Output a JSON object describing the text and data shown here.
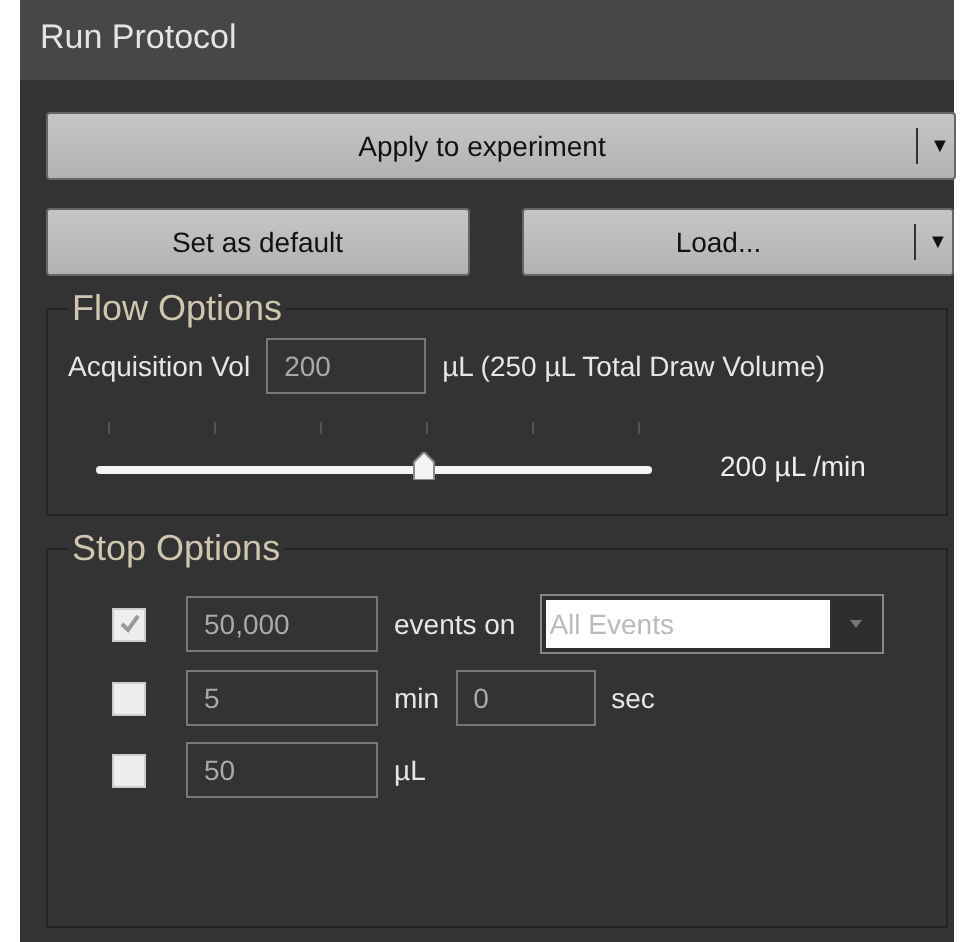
{
  "window": {
    "title": "Run Protocol"
  },
  "buttons": {
    "apply": {
      "label": "Apply to experiment",
      "arrow": "▼"
    },
    "set_default": {
      "label": "Set as default"
    },
    "load": {
      "label": "Load...",
      "arrow": "▼"
    }
  },
  "flow_options": {
    "title": "Flow Options",
    "acquisition_label": "Acquisition Vol",
    "acquisition_value": "200",
    "acquisition_unit": "µL (250 µL Total Draw Volume)",
    "flow_rate": {
      "level": 0.59,
      "reading": "200 µL /min"
    }
  },
  "stop_options": {
    "title": "Stop Options",
    "rows": [
      {
        "kind": "events",
        "checked": true,
        "value": "50,000",
        "unit": "events on",
        "select": "All Events"
      },
      {
        "kind": "time",
        "checked": false,
        "value": "5",
        "unit": "min",
        "value2": "0",
        "unit2": "sec"
      },
      {
        "kind": "volume",
        "checked": false,
        "value": "50",
        "unit": "µL"
      }
    ]
  }
}
